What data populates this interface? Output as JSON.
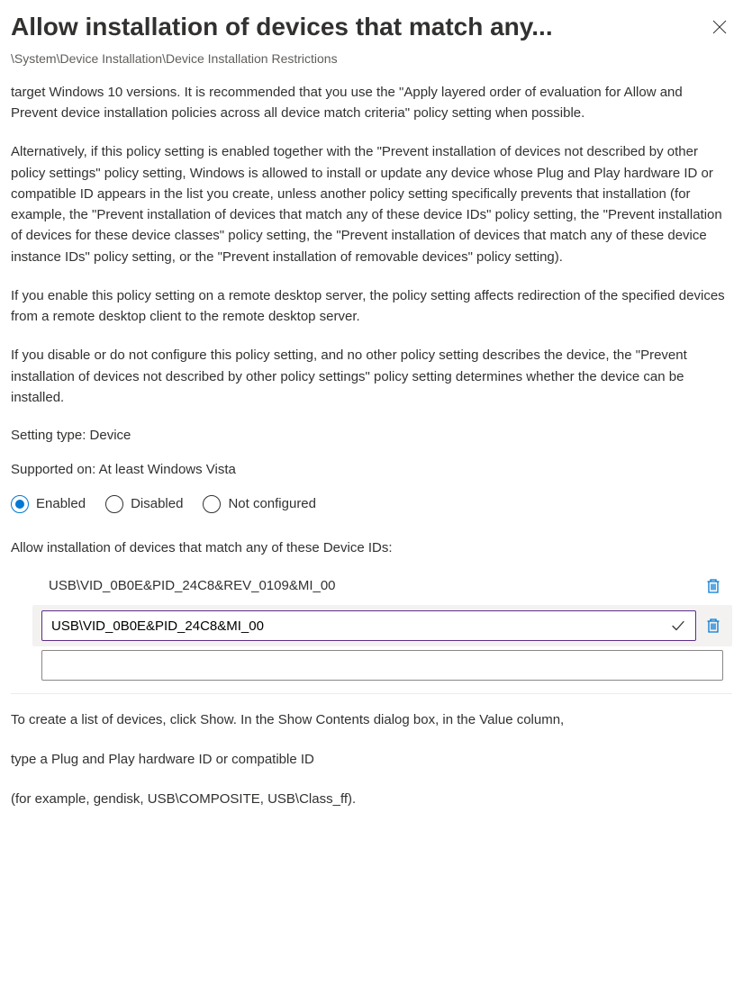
{
  "header": {
    "title": "Allow installation of devices that match any...",
    "breadcrumb": "\\System\\Device Installation\\Device Installation Restrictions"
  },
  "description": {
    "partial_top": "target Windows 10 versions. It is recommended that you use the \"Apply layered order of evaluation for Allow and Prevent device installation policies across all device match criteria\" policy setting when possible.",
    "p2": "Alternatively, if this policy setting is enabled together with the \"Prevent installation of devices not described by other policy settings\" policy setting, Windows is allowed to install or update any device whose Plug and Play hardware ID or compatible ID appears in the list you create, unless another policy setting specifically prevents that installation (for example, the \"Prevent installation of devices that match any of these device IDs\" policy setting, the \"Prevent installation of devices for these device classes\" policy setting, the \"Prevent installation of devices that match any of these device instance IDs\" policy setting, or the \"Prevent installation of removable devices\" policy setting).",
    "p3": "If you enable this policy setting on a remote desktop server, the policy setting affects redirection of the specified devices from a remote desktop client to the remote desktop server.",
    "p4": "If you disable or do not configure this policy setting, and no other policy setting describes the device, the \"Prevent installation of devices not described by other policy settings\" policy setting determines whether the device can be installed."
  },
  "meta": {
    "setting_type": "Setting type: Device",
    "supported_on": "Supported on: At least Windows Vista"
  },
  "radios": {
    "enabled": "Enabled",
    "disabled": "Disabled",
    "not_configured": "Not configured",
    "selected": "enabled"
  },
  "device_ids_section": {
    "label": "Allow installation of devices that match any of these Device IDs:",
    "rows": [
      {
        "value": "USB\\VID_0B0E&PID_24C8&REV_0109&MI_00",
        "mode": "static"
      },
      {
        "value": "USB\\VID_0B0E&PID_24C8&MI_00",
        "mode": "editing"
      }
    ],
    "new_value": ""
  },
  "footer": {
    "p1": "To create a list of devices, click Show. In the Show Contents dialog box, in the Value column,",
    "p2": "type a Plug and Play hardware ID or compatible ID",
    "p3": "(for example, gendisk, USB\\COMPOSITE, USB\\Class_ff)."
  }
}
